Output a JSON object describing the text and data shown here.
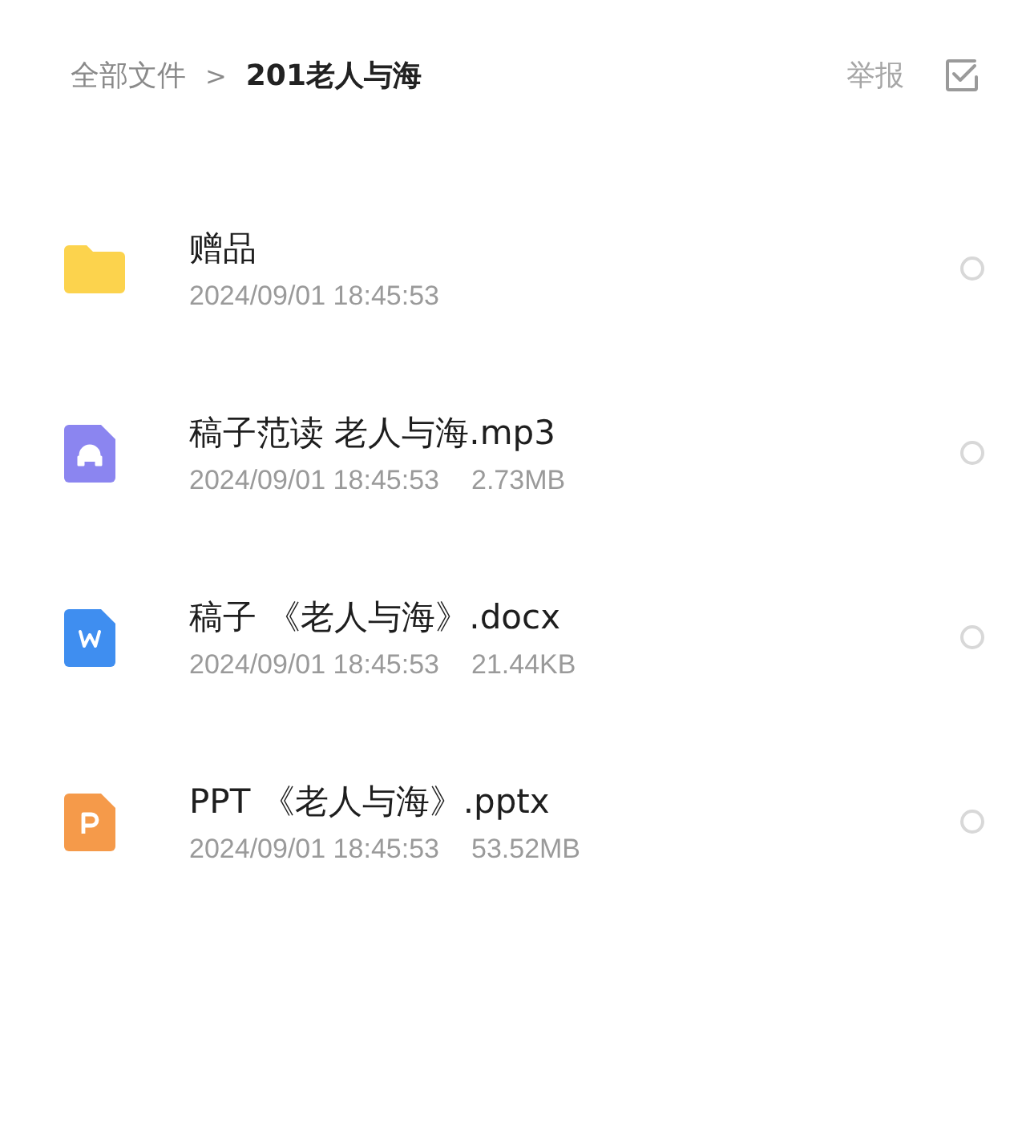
{
  "breadcrumb": {
    "root": "全部文件",
    "separator": ">",
    "current": "201老人与海"
  },
  "actions": {
    "report": "举报"
  },
  "files": [
    {
      "kind": "folder",
      "name": "赠品",
      "date": "2024/09/01 18:45:53",
      "selected": false
    },
    {
      "kind": "audio",
      "name": "稿子范读 老人与海.mp3",
      "date": "2024/09/01 18:45:53",
      "size": "2.73MB",
      "selected": false
    },
    {
      "kind": "word",
      "name": "稿子 《老人与海》.docx",
      "date": "2024/09/01 18:45:53",
      "size": "21.44KB",
      "selected": false
    },
    {
      "kind": "ppt",
      "name": "PPT 《老人与海》.pptx",
      "date": "2024/09/01 18:45:53",
      "size": "53.52MB",
      "selected": false
    }
  ]
}
